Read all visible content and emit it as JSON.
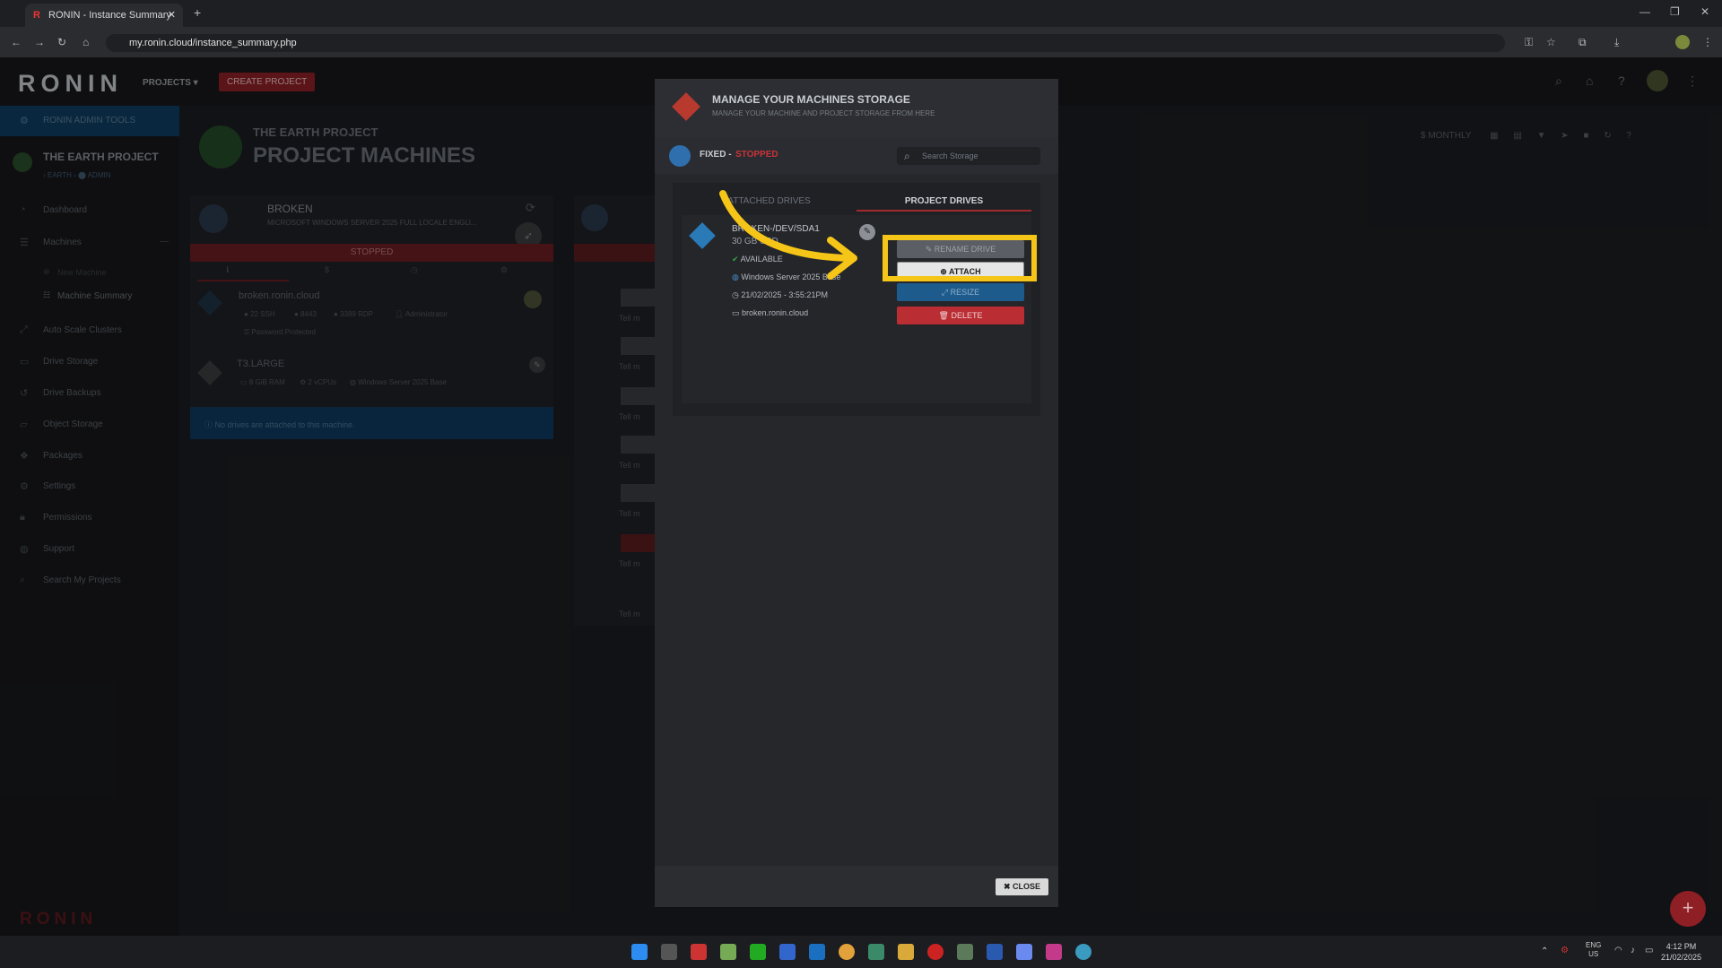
{
  "browser": {
    "tab_title": "RONIN - Instance Summary",
    "tab_favicon": "R",
    "url": "my.ronin.cloud/instance_summary.php"
  },
  "header": {
    "logo": "RONIN",
    "projects_label": "PROJECTS",
    "create_label": "CREATE PROJECT"
  },
  "sidebar": {
    "admin_label": "RONIN ADMIN TOOLS",
    "project_name": "THE EARTH PROJECT",
    "project_path": "› EARTH › ⬤ ADMIN",
    "items": [
      {
        "label": "Dashboard",
        "icon": "gauge-icon"
      },
      {
        "label": "Machines",
        "icon": "server-icon"
      },
      {
        "label": "New Machine",
        "icon": "plus-icon"
      },
      {
        "label": "Machine Summary",
        "icon": "list-icon"
      },
      {
        "label": "Auto Scale Clusters",
        "icon": "scale-icon"
      },
      {
        "label": "Drive Storage",
        "icon": "drive-icon"
      },
      {
        "label": "Drive Backups",
        "icon": "backup-icon"
      },
      {
        "label": "Object Storage",
        "icon": "folder-icon"
      },
      {
        "label": "Packages",
        "icon": "package-icon"
      },
      {
        "label": "Settings",
        "icon": "gear-icon"
      },
      {
        "label": "Permissions",
        "icon": "lock-icon"
      },
      {
        "label": "Support",
        "icon": "globe-icon"
      },
      {
        "label": "Search My Projects",
        "icon": "search-icon"
      }
    ],
    "footer_logo": "RONIN"
  },
  "main": {
    "project_label": "THE EARTH PROJECT",
    "page_title": "PROJECT MACHINES",
    "toolbar_monthly": "$ MONTHLY",
    "machine": {
      "name": "BROKEN",
      "os": "MICROSOFT WINDOWS SERVER 2025 FULL LOCALE ENGLI...",
      "status": "STOPPED",
      "host": "broken.ronin.cloud",
      "ports": [
        "22 SSH",
        "8443",
        "3389 RDP"
      ],
      "user": "Administrator",
      "password": "Password Protected",
      "type": "T3.LARGE",
      "ram": "8 GiB RAM",
      "cpus": "2 vCPUs",
      "image": "Windows Server 2025 Base",
      "no_drives": "No drives are attached to this machine."
    },
    "tell_label": "Tell m"
  },
  "modal": {
    "title": "MANAGE YOUR MACHINES STORAGE",
    "subtitle": "MANAGE YOUR MACHINE AND PROJECT STORAGE FROM HERE",
    "fixed_label": "FIXED -",
    "stopped_label": "STOPPED",
    "search_placeholder": "Search Storage",
    "tab_attached": "ATTACHED DRIVES",
    "tab_project": "PROJECT DRIVES",
    "drive": {
      "name": "BROKEN-/DEV/SDA1",
      "size": "30 GB SSD",
      "status": "AVAILABLE",
      "os": "Windows Server 2025 Base",
      "date": "21/02/2025 - 3:55:21PM",
      "host": "broken.ronin.cloud"
    },
    "btn_top": "✎ RENAME DRIVE",
    "btn_attach": "ATTACH",
    "btn_resize": "RESIZE",
    "btn_delete": "DELETE",
    "close_label": "CLOSE",
    "highlight_color": "#f5c518"
  },
  "taskbar": {
    "lang": "ENG",
    "region": "US",
    "time": "4:12 PM",
    "date": "21/02/2025"
  }
}
